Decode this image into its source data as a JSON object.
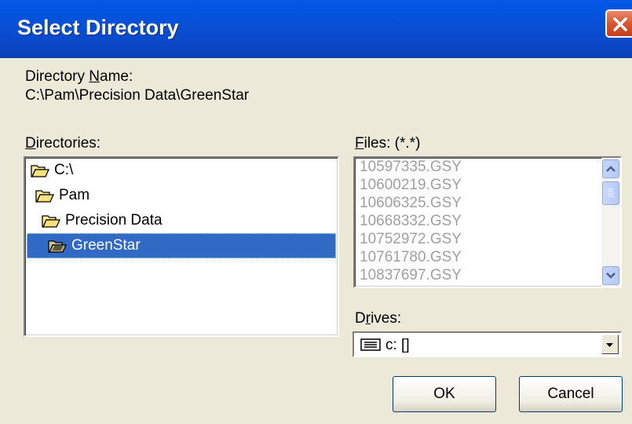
{
  "window": {
    "title": "Select Directory"
  },
  "directory_name": {
    "label": "Directory Name:",
    "label_access_key": "N",
    "value": "C:\\Pam\\Precision Data\\GreenStar"
  },
  "directories": {
    "label": "Directories:",
    "items": [
      {
        "label": "C:\\",
        "state": "open"
      },
      {
        "label": "Pam",
        "state": "open"
      },
      {
        "label": "Precision Data",
        "state": "open"
      },
      {
        "label": "GreenStar",
        "state": "open-selected"
      }
    ]
  },
  "files": {
    "label": "Files: (*.*)",
    "items": [
      "10597335.GSY",
      "10600219.GSY",
      "10606325.GSY",
      "10668332.GSY",
      "10752972.GSY",
      "10761780.GSY",
      "10837697.GSY"
    ]
  },
  "drives": {
    "label": "Drives:",
    "selected": "c: []"
  },
  "buttons": {
    "ok": "OK",
    "cancel": "Cancel"
  },
  "colors": {
    "title_bar": "#0a4fd4",
    "selection": "#316ac5",
    "dialog_bg": "#ece9d8",
    "close_button": "#d8552f"
  }
}
